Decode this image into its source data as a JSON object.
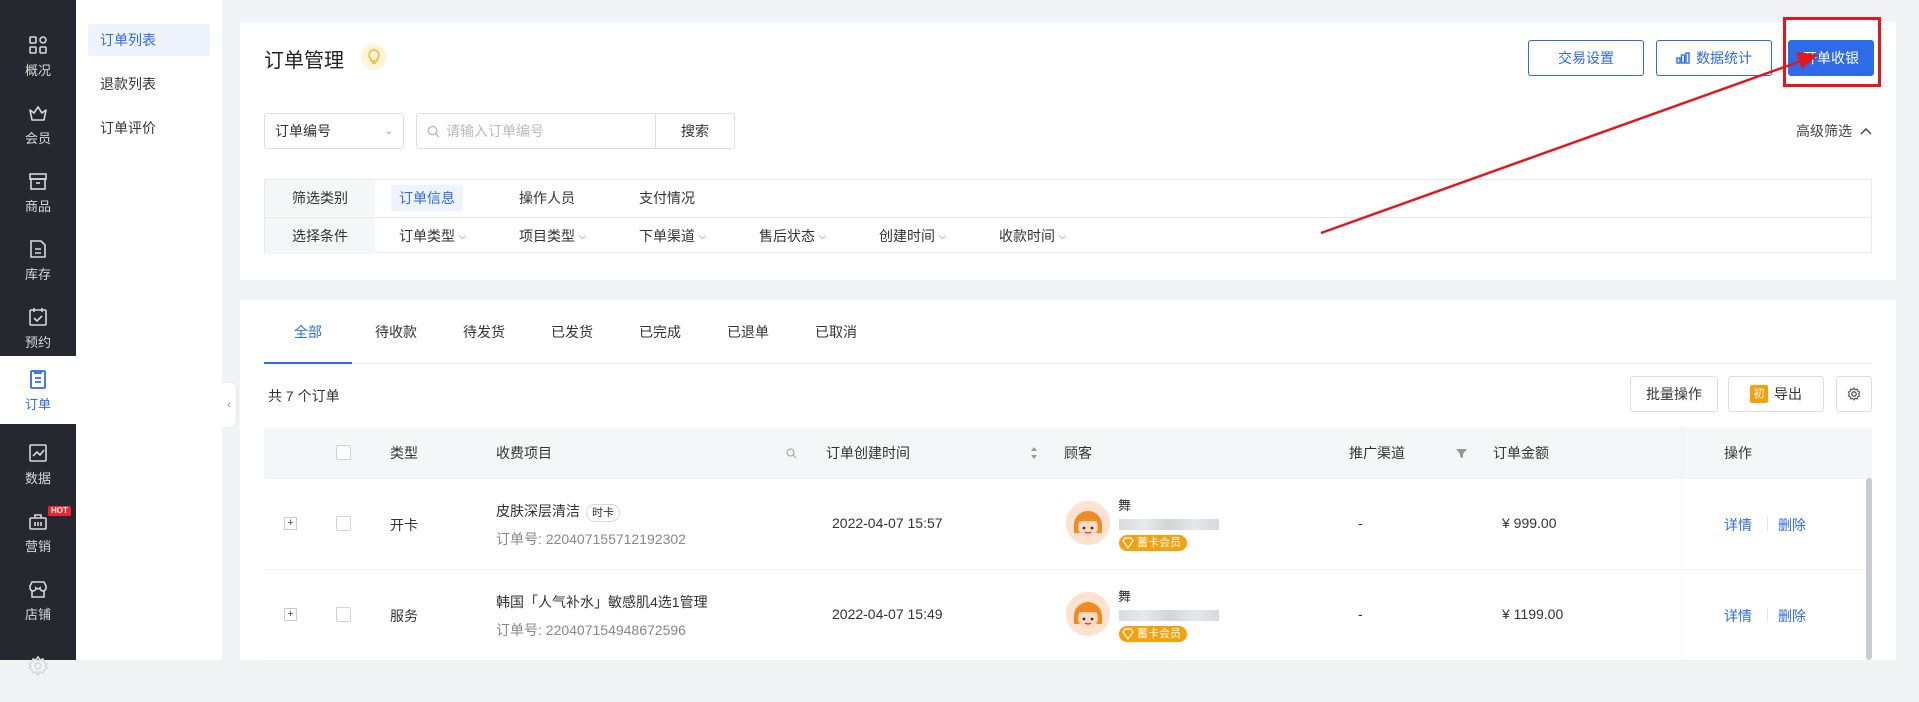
{
  "nav": {
    "items": [
      {
        "label": "概况",
        "icon": "dashboard-icon"
      },
      {
        "label": "会员",
        "icon": "crown-icon"
      },
      {
        "label": "商品",
        "icon": "store-goods-icon"
      },
      {
        "label": "库存",
        "icon": "inventory-icon"
      },
      {
        "label": "预约",
        "icon": "calendar-check-icon"
      },
      {
        "label": "订单",
        "icon": "order-icon"
      },
      {
        "label": "数据",
        "icon": "chart-icon"
      },
      {
        "label": "营销",
        "icon": "marketing-icon",
        "badge": "HOT"
      },
      {
        "label": "店铺",
        "icon": "shop-icon"
      },
      {
        "label": "",
        "icon": "settings-icon"
      }
    ],
    "active": "订单"
  },
  "submenu": {
    "items": [
      "订单列表",
      "退款列表",
      "订单评价"
    ],
    "active": "订单列表"
  },
  "header": {
    "title": "订单管理",
    "buttons": {
      "trade_settings": "交易设置",
      "data_stats": "数据统计",
      "checkout": "开单收银"
    }
  },
  "search": {
    "select_value": "订单编号",
    "placeholder": "请输入订单编号",
    "search_label": "搜索",
    "advanced_label": "高级筛选"
  },
  "filter": {
    "row1_label": "筛选类别",
    "categories": [
      "订单信息",
      "操作人员",
      "支付情况"
    ],
    "row2_label": "选择条件",
    "conditions": [
      "订单类型",
      "项目类型",
      "下单渠道",
      "售后状态",
      "创建时间",
      "收款时间"
    ]
  },
  "tabs": [
    "全部",
    "待收款",
    "待发货",
    "已发货",
    "已完成",
    "已退单",
    "已取消"
  ],
  "active_tab": "全部",
  "list": {
    "count_text": "共 7 个订单",
    "batch_label": "批量操作",
    "export_label": "导出",
    "export_badge": "初"
  },
  "table": {
    "headers": {
      "type": "类型",
      "item": "收费项目",
      "created": "订单创建时间",
      "customer": "顾客",
      "channel": "推广渠道",
      "amount": "订单金额",
      "ops": "操作"
    },
    "rows": [
      {
        "type": "开卡",
        "item": "皮肤深层清洁",
        "item_tag": "时卡",
        "order_no": "订单号: 220407155712192302",
        "created": "2022-04-07 15:57",
        "customer_name": "舞",
        "vip": "蓄卡会员",
        "channel": "-",
        "amount": "¥ 999.00",
        "detail": "详情",
        "delete": "删除"
      },
      {
        "type": "服务",
        "item": "韩国「人气补水」敏感肌4选1管理",
        "item_tag": "",
        "order_no": "订单号: 220407154948672596",
        "created": "2022-04-07 15:49",
        "customer_name": "舞",
        "vip": "蓄卡会员",
        "channel": "-",
        "amount": "¥ 1199.00",
        "detail": "详情",
        "delete": "删除"
      }
    ]
  },
  "colors": {
    "primary": "#2e6be6",
    "nav_bg": "#25282e",
    "annotation_red": "#e3161e",
    "vip_orange": "#f4a10d"
  }
}
